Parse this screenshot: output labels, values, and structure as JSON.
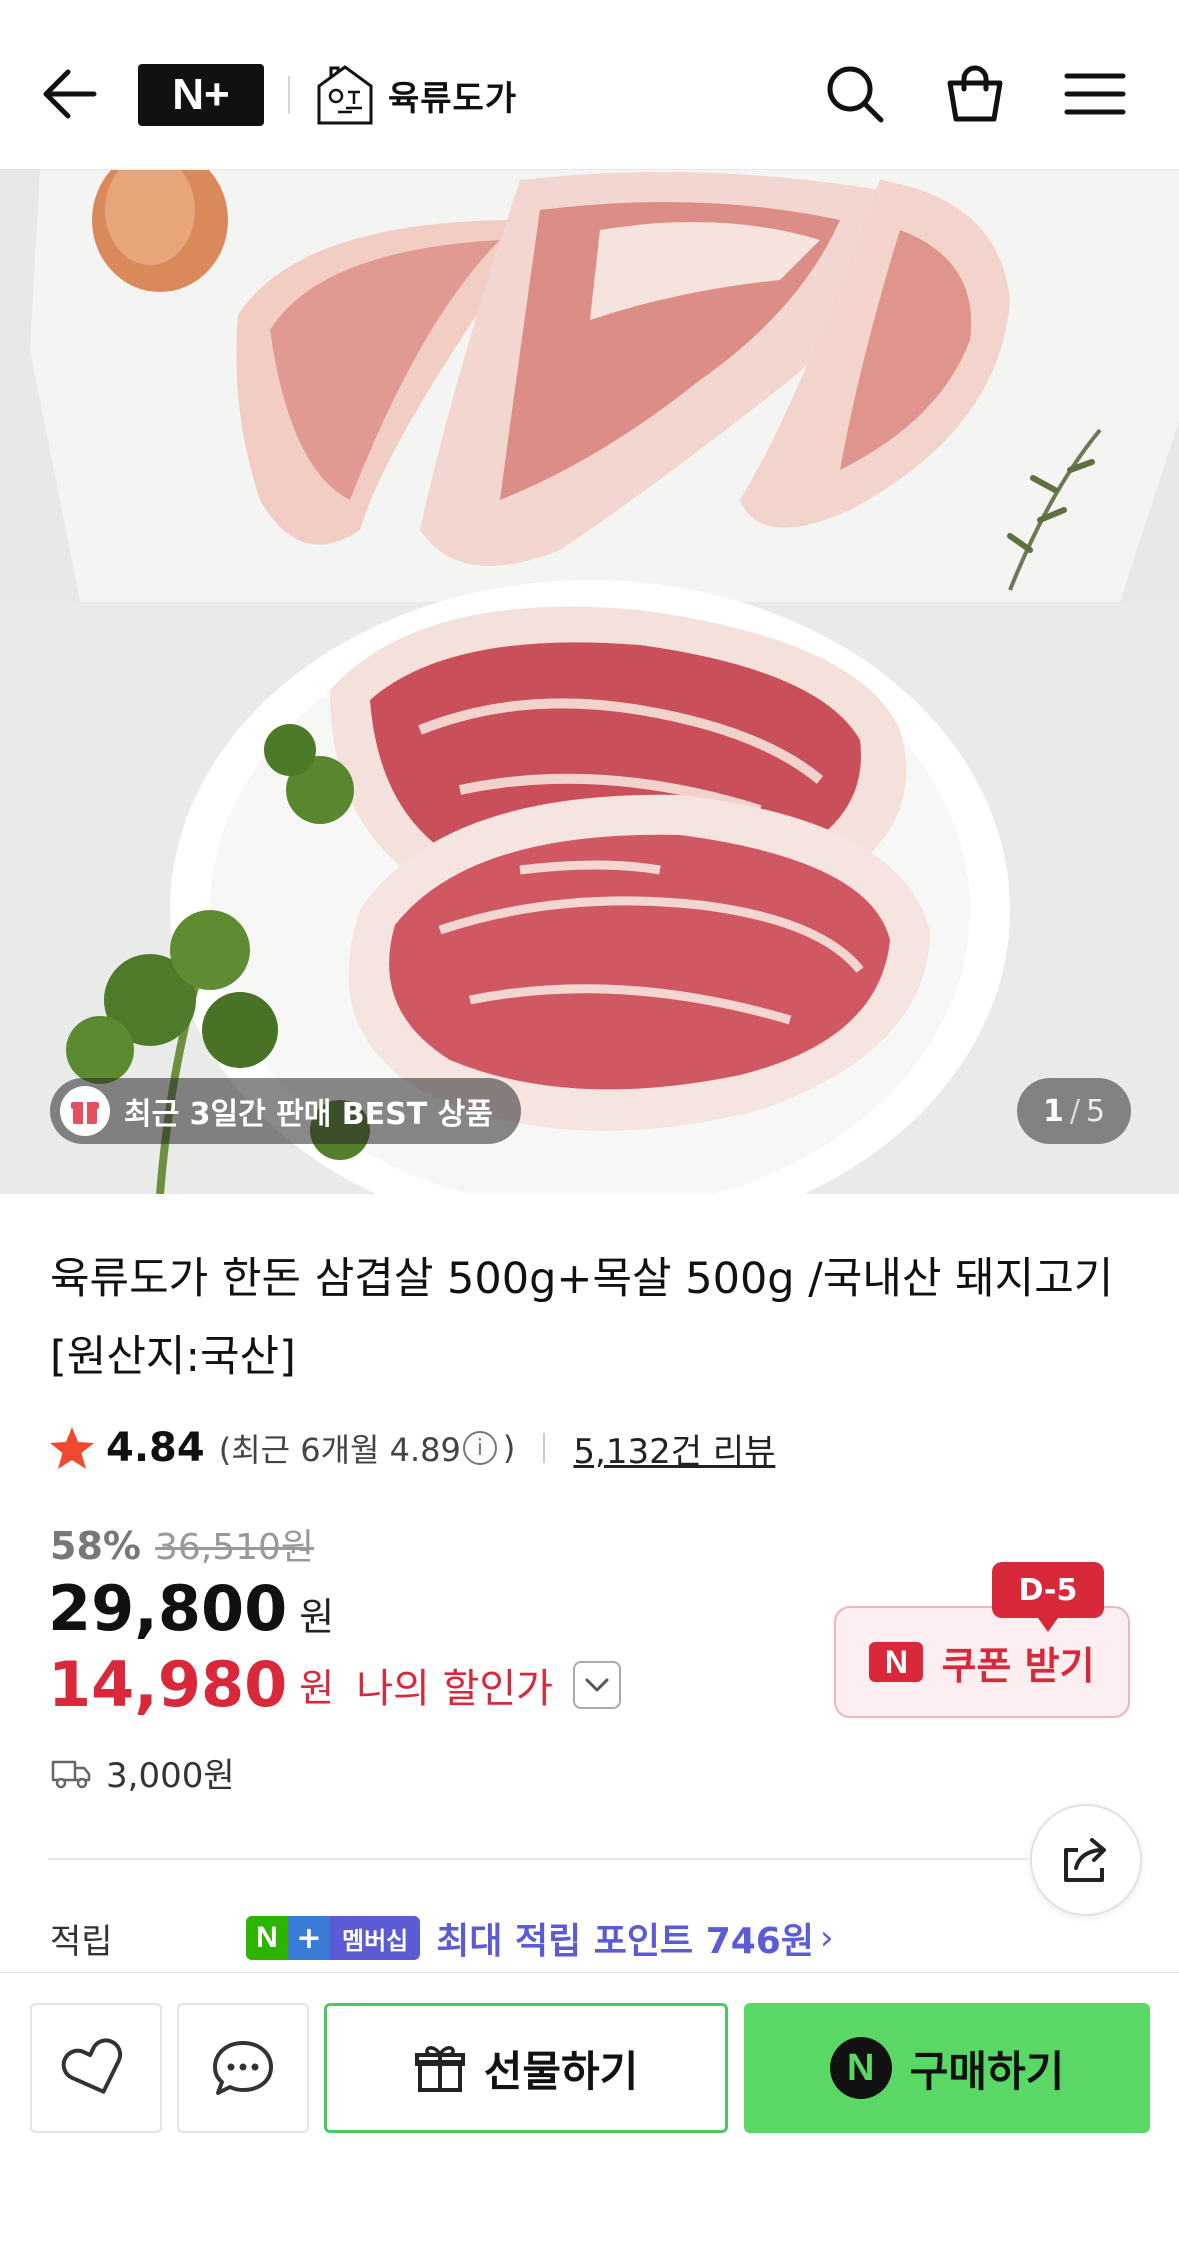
{
  "header": {
    "brand_logo": "N+",
    "store_name": "육류도가",
    "store_mark_text": "육류도가"
  },
  "gallery": {
    "badge_text": "최근 3일간 판매 BEST 상품",
    "current": "1",
    "separator": "/",
    "total": "5"
  },
  "product": {
    "title": "육류도가 한돈 삼겹살 500g+목살 500g /국내산 돼지고기 [원산지:국산]",
    "rating": "4.84",
    "recent_rating_prefix": "(최근 6개월 4.89",
    "recent_rating_suffix": ")",
    "info_icon_glyph": "i",
    "review_count": "5,132건 리뷰"
  },
  "pricing": {
    "discount_percent": "58%",
    "original_price": "36,510원",
    "price": "29,800",
    "price_unit": "원",
    "my_price": "14,980",
    "my_price_unit": "원",
    "my_price_label": "나의 할인가",
    "coupon_label": "쿠폰 받기",
    "coupon_badge": "N",
    "coupon_dday": "D-5",
    "accent_color": "#d9283a"
  },
  "shipping": {
    "fee": "3,000원"
  },
  "points": {
    "label": "적립",
    "membership_n": "N",
    "membership_plus": "+",
    "membership_text": "멤버십",
    "max_points_text": "최대 적립 포인트 746원",
    "chevron": "›"
  },
  "bottom_bar": {
    "gift_label": "선물하기",
    "buy_label": "구매하기",
    "buy_badge": "N",
    "buy_color": "#5ad865"
  }
}
